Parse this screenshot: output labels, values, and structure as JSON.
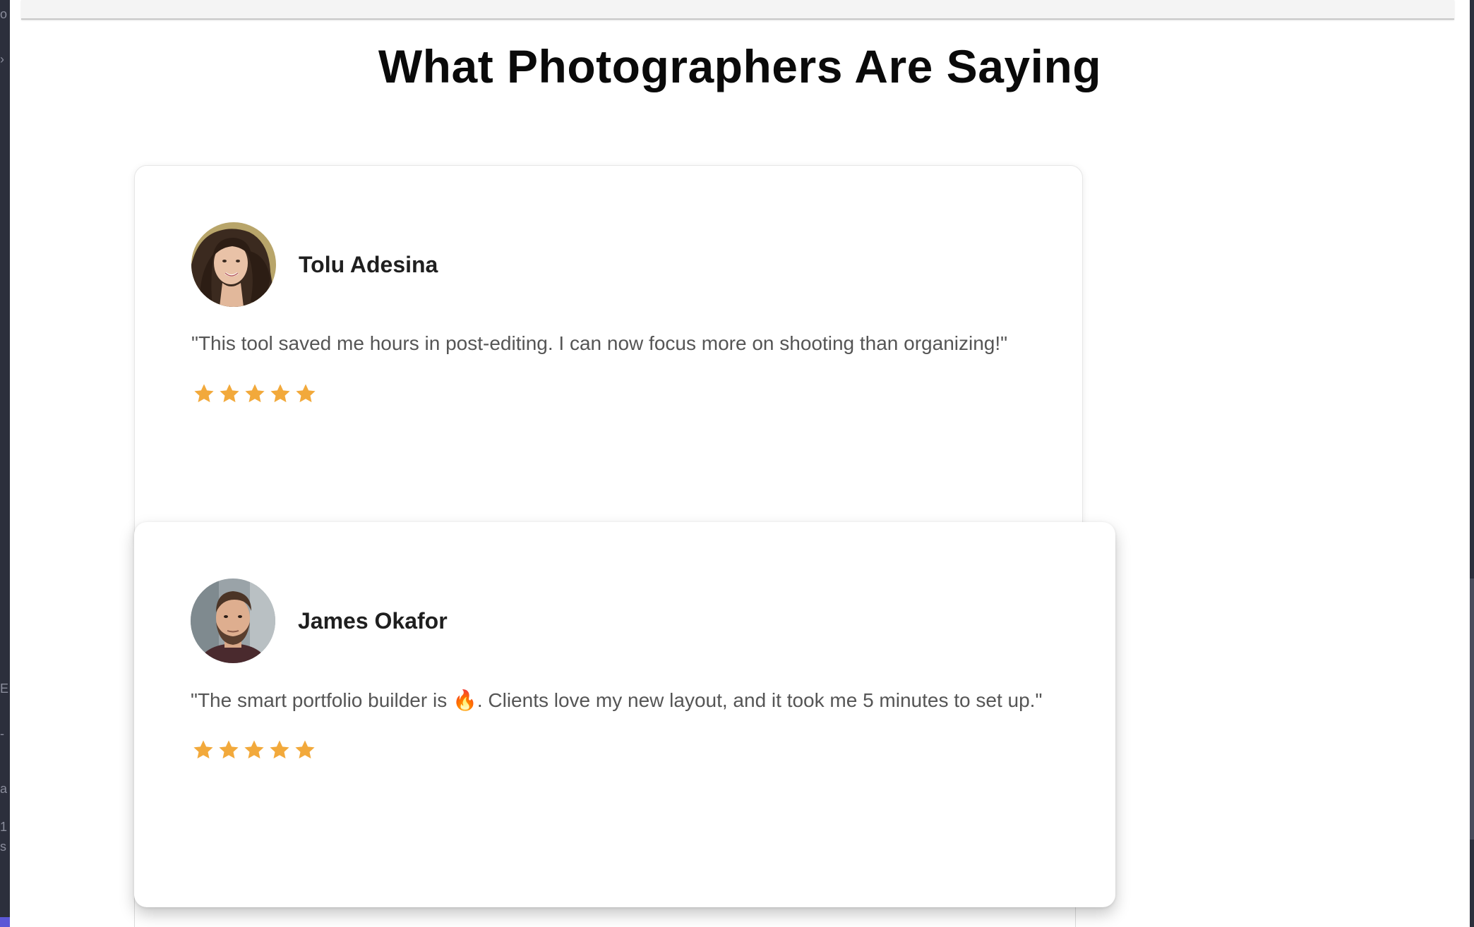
{
  "section": {
    "title": "What Photographers Are Saying"
  },
  "testimonials": [
    {
      "name": "Tolu Adesina",
      "quote": "\"This tool saved me hours in post-editing. I can now focus more on shooting than organizing!\"",
      "rating": 5,
      "avatar": "woman-portrait-avatar"
    },
    {
      "name": "James Okafor",
      "quote": "\"The smart portfolio builder is 🔥. Clients love my new layout, and it took me 5 minutes to set up.\"",
      "rating": 5,
      "avatar": "man-portrait-avatar"
    }
  ],
  "colors": {
    "star": "#F2A93B",
    "title": "#0A0A0A",
    "name": "#1F1F1F",
    "quote": "#555555",
    "card_background": "#FFFFFF",
    "editor_chrome": "#2C2F3C"
  },
  "icons": {
    "rating_star": "star-icon"
  }
}
